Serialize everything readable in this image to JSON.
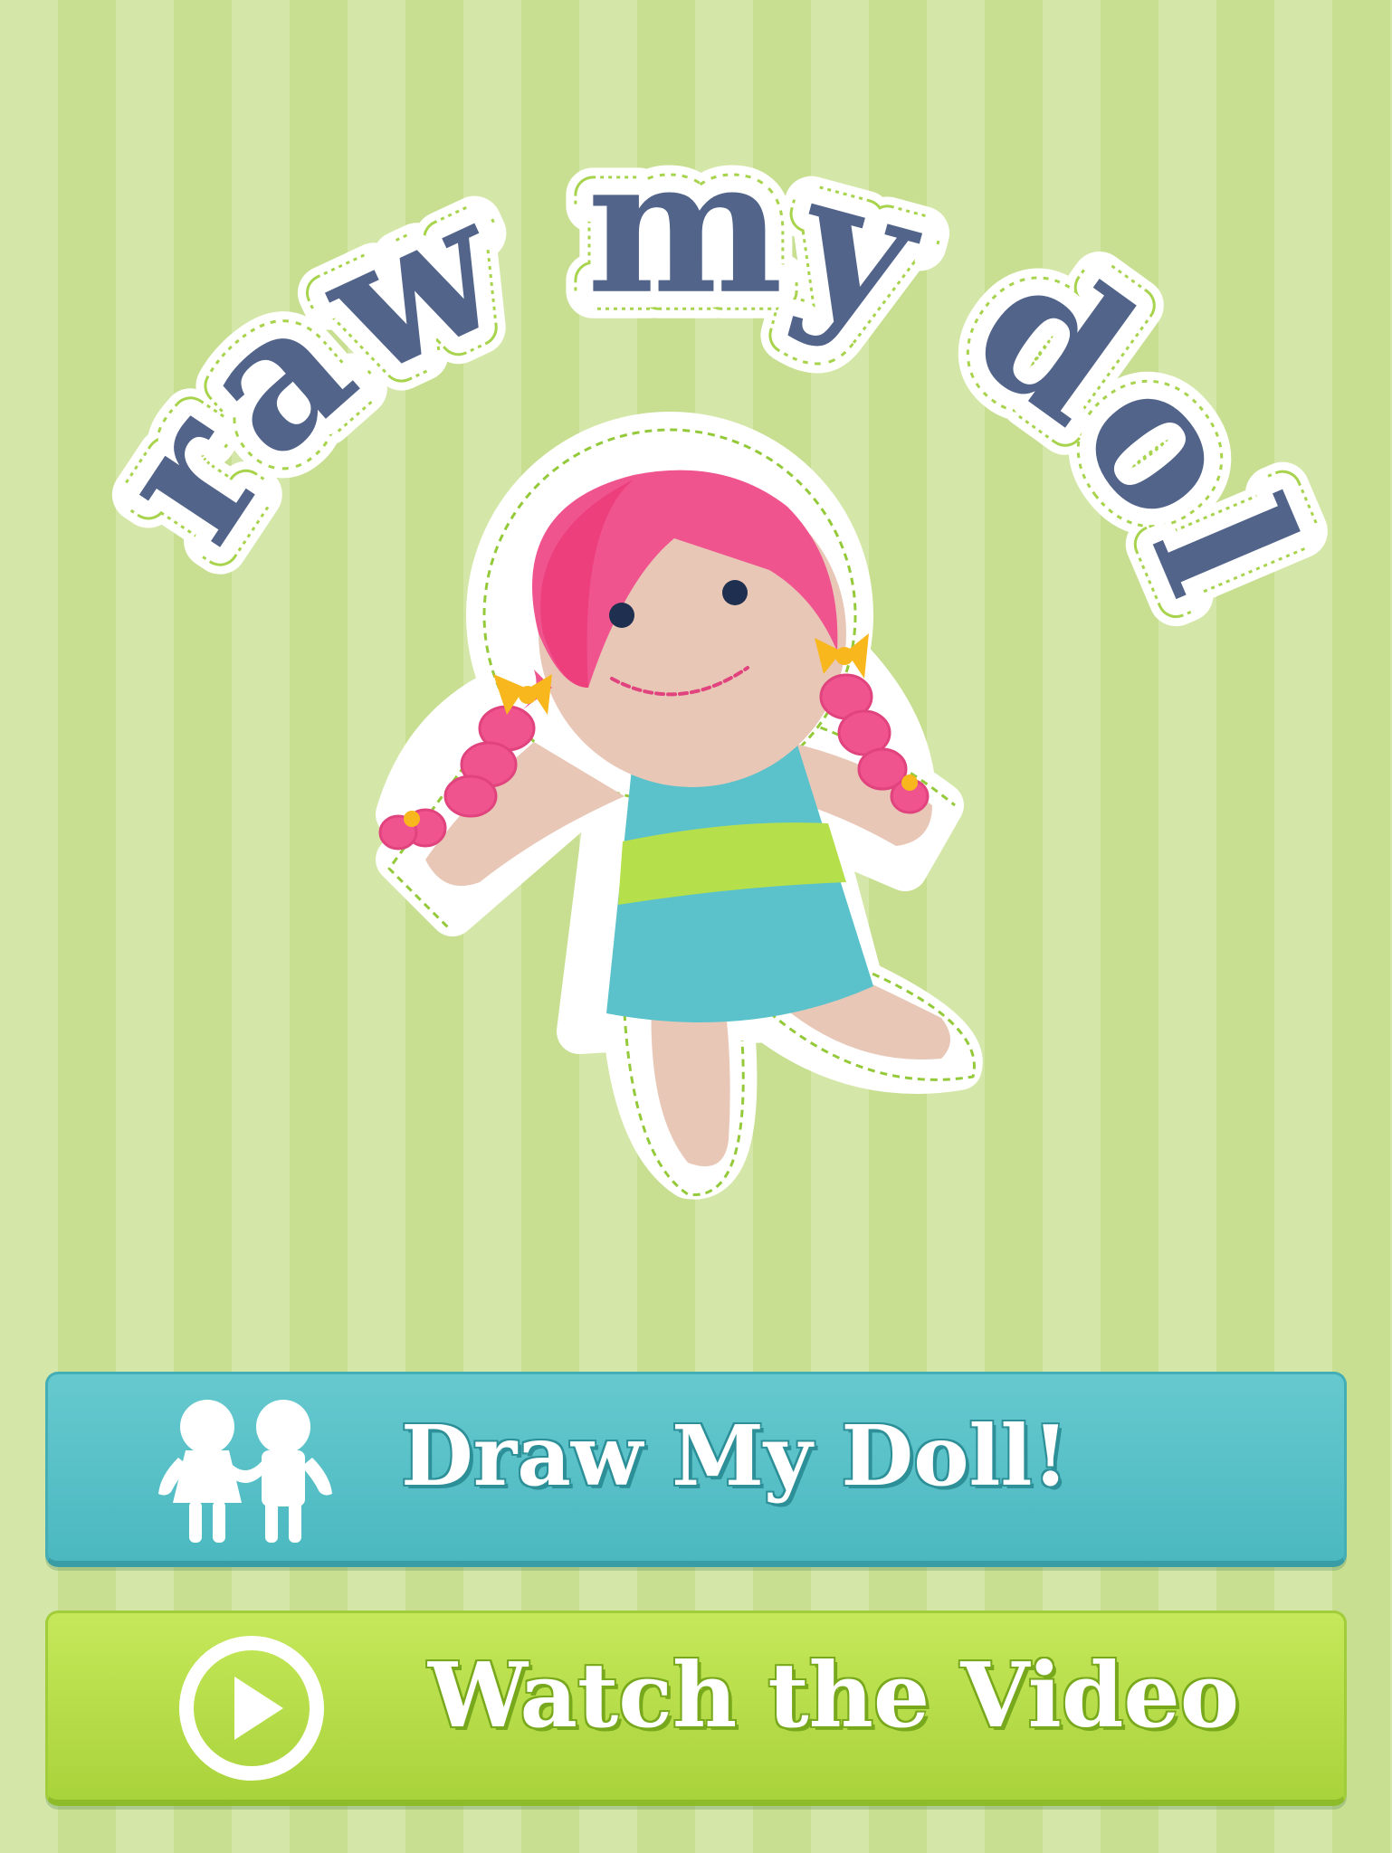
{
  "app": {
    "logo_text": "draw my doll"
  },
  "buttons": {
    "draw_label": "Draw My Doll!",
    "video_label": "Watch the Video"
  },
  "icons": {
    "draw_button_icon": "two-kids-holding-hands-icon",
    "video_button_icon": "play-circle-icon",
    "hero": "rag-doll-illustration"
  },
  "colors": {
    "background_light": "#d5e7a8",
    "background_dark": "#c8df92",
    "logo_text": "#52648a",
    "doll_hair": "#f0548f",
    "doll_dress": "#5bc2cb",
    "doll_stripe": "#b5e04b",
    "bow": "#f7b71d",
    "draw_button": "#56c0c7",
    "video_button": "#b5dd48"
  }
}
